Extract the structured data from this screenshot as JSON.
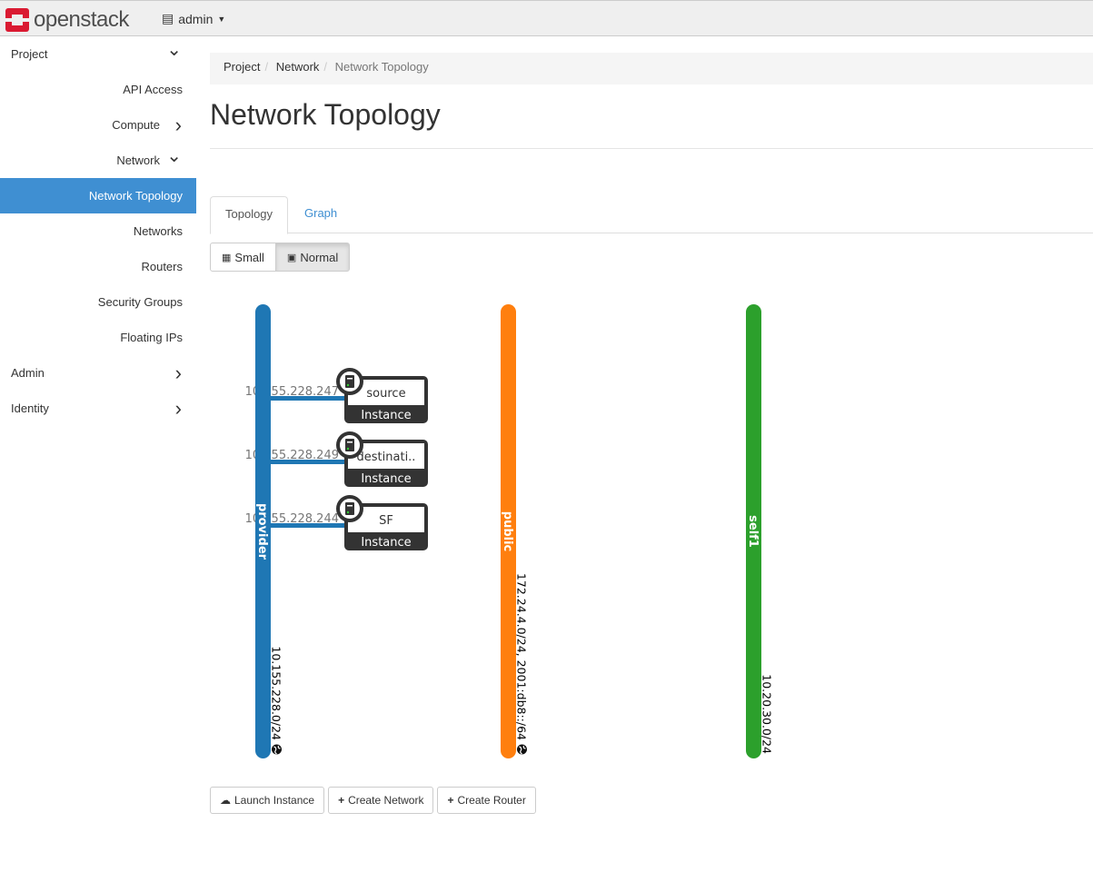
{
  "header": {
    "brand": "openstack",
    "project_label": "admin"
  },
  "sidebar": {
    "items": [
      {
        "label": "Project",
        "level": "top",
        "chevron": "down"
      },
      {
        "label": "API Access",
        "level": "sub"
      },
      {
        "label": "Compute",
        "level": "sub",
        "chevron": "right"
      },
      {
        "label": "Network",
        "level": "sub",
        "chevron": "down"
      },
      {
        "label": "Network Topology",
        "level": "sub2",
        "active": true
      },
      {
        "label": "Networks",
        "level": "sub2"
      },
      {
        "label": "Routers",
        "level": "sub2"
      },
      {
        "label": "Security Groups",
        "level": "sub2"
      },
      {
        "label": "Floating IPs",
        "level": "sub2"
      },
      {
        "label": "Admin",
        "level": "top",
        "chevron": "right"
      },
      {
        "label": "Identity",
        "level": "top",
        "chevron": "right"
      }
    ]
  },
  "breadcrumb": [
    "Project",
    "Network",
    "Network Topology"
  ],
  "page_title": "Network Topology",
  "tabs": [
    {
      "label": "Topology",
      "active": true
    },
    {
      "label": "Graph"
    }
  ],
  "view_buttons": [
    {
      "label": "Small",
      "icon": "th-icon"
    },
    {
      "label": "Normal",
      "icon": "th-large-icon",
      "active": true
    }
  ],
  "networks": [
    {
      "name": "provider",
      "subnet": "10.155.228.0/24",
      "external": true,
      "color": "#1f77b4"
    },
    {
      "name": "public",
      "subnet": "172.24.4.0/24, 2001:db8::/64",
      "external": true,
      "color": "#ff7f0e"
    },
    {
      "name": "self1",
      "subnet": "10.20.30.0/24",
      "external": false,
      "color": "#2ca02c"
    }
  ],
  "instances": [
    {
      "name": "source",
      "type": "Instance",
      "ip": "10.155.228.247"
    },
    {
      "name": "destinati..",
      "type": "Instance",
      "ip": "10.155.228.249"
    },
    {
      "name": "SF",
      "type": "Instance",
      "ip": "10.155.228.244"
    }
  ],
  "actions": [
    {
      "label": "Launch Instance",
      "icon": "cloud-upload-icon"
    },
    {
      "label": "Create Network",
      "icon": "plus-icon"
    },
    {
      "label": "Create Router",
      "icon": "plus-icon"
    }
  ]
}
